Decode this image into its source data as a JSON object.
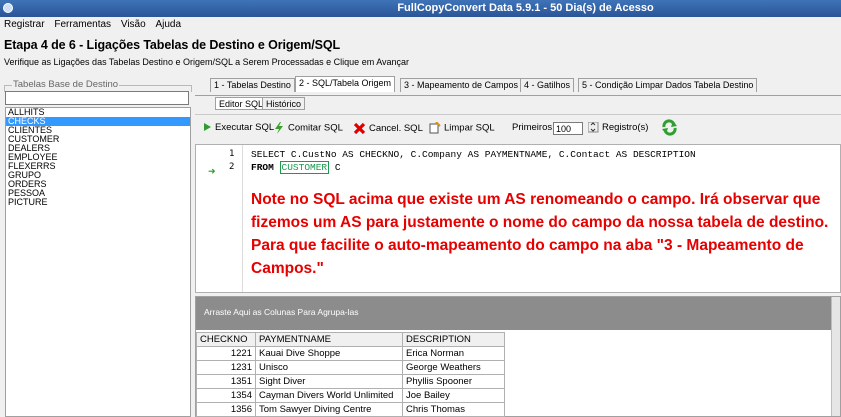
{
  "window": {
    "title": "FullCopyConvert Data 5.9.1 - 50 Dia(s) de Acesso"
  },
  "menu": [
    "Registrar",
    "Ferramentas",
    "Visão",
    "Ajuda"
  ],
  "step": {
    "title": "Etapa 4 de 6 - Ligações Tabelas de Destino e Origem/SQL",
    "subtitle": "Verifique as Ligações das Tabelas Destino e Origem/SQL a Serem Processadas e Clique em Avançar"
  },
  "left_panel": {
    "group_label": "Tabelas Base de Destino",
    "search_value": "",
    "tables": [
      "ALLHITS",
      "CHECKS",
      "CLIENTES",
      "CUSTOMER",
      "DEALERS",
      "EMPLOYEE",
      "FLEXERRS",
      "GRUPO",
      "ORDERS",
      "PESSOA",
      "PICTURE"
    ],
    "selected": "CHECKS"
  },
  "tabs": [
    "1 - Tabelas Destino",
    "2 - SQL/Tabela Origem",
    "3 - Mapeamento de Campos",
    "4 - Gatilhos",
    "5 - Condição Limpar Dados Tabela Destino"
  ],
  "active_tab": "2 - SQL/Tabela Origem",
  "subtabs": [
    "Editor SQL",
    "Histórico"
  ],
  "toolbar": {
    "execute": "Executar SQL",
    "commit": "Comitar SQL",
    "cancel": "Cancel. SQL",
    "clear": "Limpar SQL",
    "first_label": "Primeiros:",
    "first_value": "100",
    "records": "Registro(s)"
  },
  "editor": {
    "lines": [
      {
        "number": "1",
        "text": "SELECT C.CustNo AS CHECKNO, C.Company AS PAYMENTNAME, C.Contact AS DESCRIPTION"
      },
      {
        "number": "2",
        "from": "FROM",
        "table": "CUSTOMER",
        "alias": "C"
      }
    ],
    "note": "Note no SQL acima que existe um AS renomeando o campo. Irá observar que fizemos um AS para justamente o nome do campo da nossa tabela de destino. Para que facilite o auto-mapeamento do campo na aba \"3 - Mapeamento de Campos.\""
  },
  "grid": {
    "group_hint": "Arraste Aqui as Colunas Para Agrupa-las",
    "columns": [
      "CHECKNO",
      "PAYMENTNAME",
      "DESCRIPTION"
    ],
    "rows": [
      [
        "1221",
        "Kauai Dive Shoppe",
        "Erica Norman"
      ],
      [
        "1231",
        "Unisco",
        "George Weathers"
      ],
      [
        "1351",
        "Sight Diver",
        "Phyllis Spooner"
      ],
      [
        "1354",
        "Cayman Divers World Unlimited",
        "Joe Bailey"
      ],
      [
        "1356",
        "Tom Sawyer Diving Centre",
        "Chris Thomas"
      ]
    ]
  },
  "colors": {
    "titlebar": "#2a5597",
    "selection": "#3399ff",
    "note": "#e60000",
    "table_highlight": "#1a9c4e"
  }
}
